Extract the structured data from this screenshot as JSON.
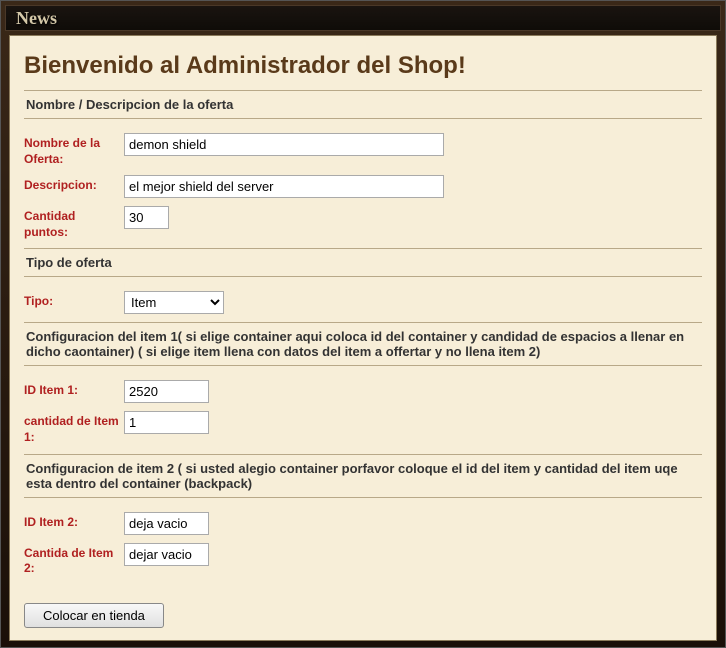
{
  "header": {
    "title": "News"
  },
  "page": {
    "title": "Bienvenido al Administrador del Shop!"
  },
  "section1": {
    "heading": "Nombre / Descripcion de la oferta",
    "name_label": "Nombre de la Oferta:",
    "name_value": "demon shield",
    "desc_label": "Descripcion:",
    "desc_value": "el mejor shield del server",
    "points_label": "Cantidad puntos:",
    "points_value": "30"
  },
  "section2": {
    "heading": "Tipo de oferta",
    "tipo_label": "Tipo:",
    "tipo_value": "Item"
  },
  "section3": {
    "heading": "Configuracion del item 1( si elige container aqui coloca id del container y candidad de espacios a llenar en dicho caontainer) ( si elige item llena con datos del item a offertar y no llena item 2)",
    "id1_label": "ID Item 1:",
    "id1_value": "2520",
    "qty1_label": "cantidad de Item 1:",
    "qty1_value": "1"
  },
  "section4": {
    "heading": "Configuracion de item 2 ( si usted alegio container porfavor coloque el id del item y cantidad del item uqe esta dentro del container (backpack)",
    "id2_label": "ID Item 2:",
    "id2_value": "deja vacio",
    "qty2_label": "Cantida de Item 2:",
    "qty2_value": "dejar vacio"
  },
  "submit": {
    "label": "Colocar en tienda"
  }
}
